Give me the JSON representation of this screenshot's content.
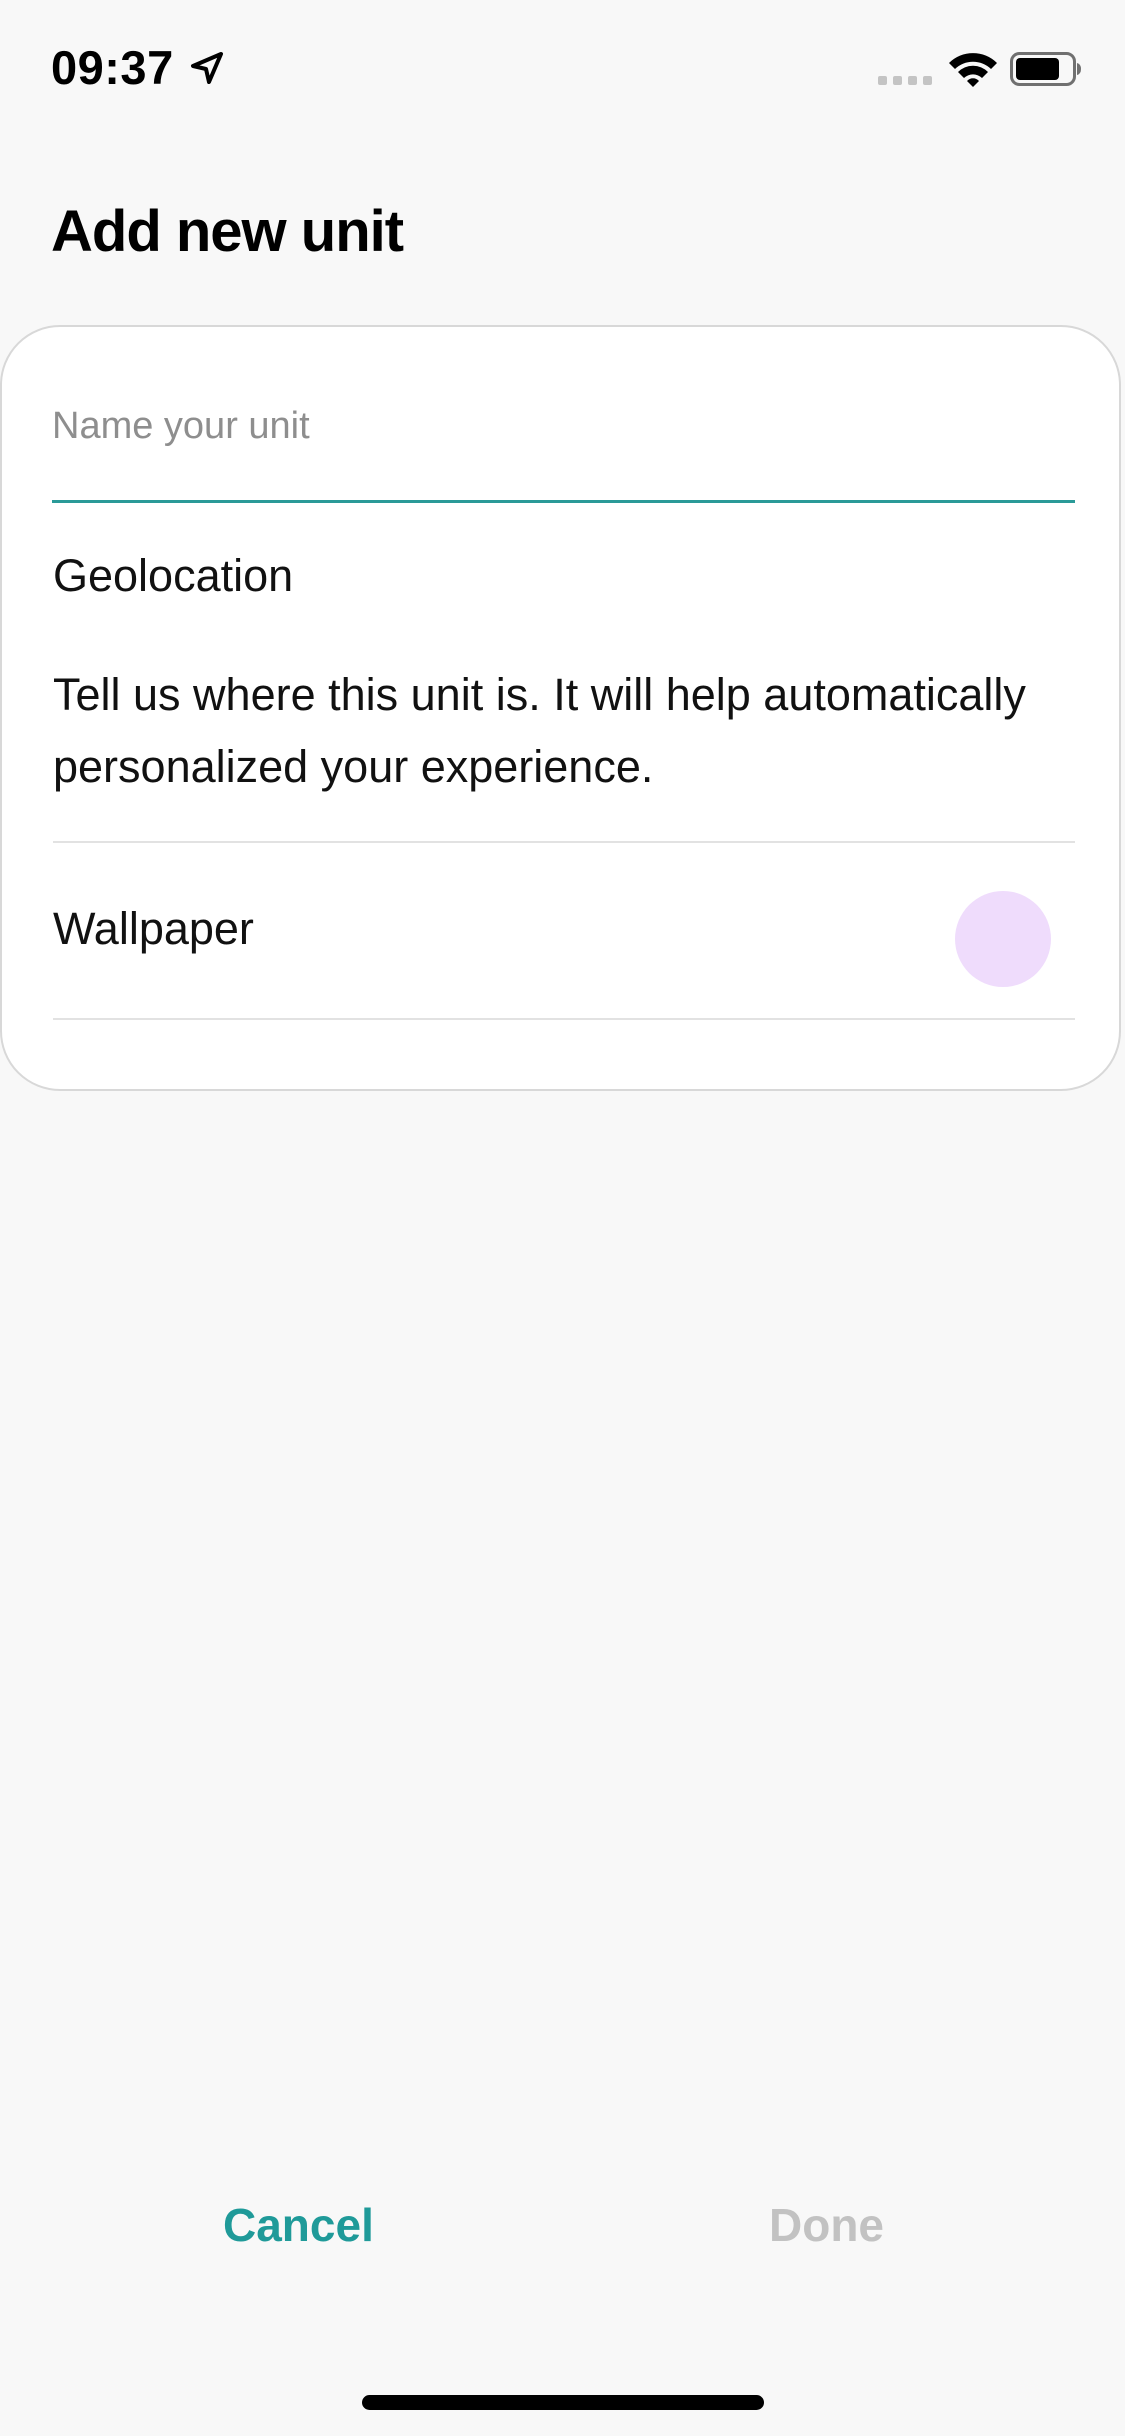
{
  "status_bar": {
    "time": "09:37",
    "location_icon": "location-arrow-icon",
    "signal_icon": "cellular-signal-icon",
    "wifi_icon": "wifi-icon",
    "battery_icon": "battery-icon",
    "battery_level": 0.75
  },
  "header": {
    "title": "Add new unit"
  },
  "form": {
    "name_field": {
      "value": "",
      "placeholder": "Name your unit"
    },
    "geolocation": {
      "label": "Geolocation",
      "description": "Tell us where this unit is. It will help automatically personalized your experience."
    },
    "wallpaper": {
      "label": "Wallpaper",
      "swatch_color": "#efdcfc"
    }
  },
  "footer": {
    "cancel_label": "Cancel",
    "done_label": "Done"
  },
  "colors": {
    "accent": "#1f9a99",
    "disabled": "#c2c2c2",
    "background": "#f8f8f8"
  }
}
